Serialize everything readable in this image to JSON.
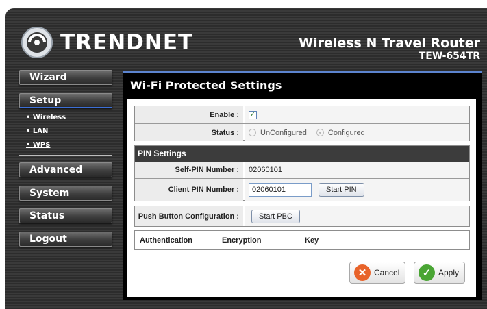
{
  "header": {
    "brand": "TRENDNET",
    "product": "Wireless N Travel Router",
    "model": "TEW-654TR"
  },
  "sidebar": {
    "items": [
      {
        "label": "Wizard"
      },
      {
        "label": "Setup"
      },
      {
        "label": "Advanced"
      },
      {
        "label": "System"
      },
      {
        "label": "Status"
      },
      {
        "label": "Logout"
      }
    ],
    "setup_submenu": [
      "Wireless",
      "LAN",
      "WPS"
    ],
    "submenu_bullet": "•"
  },
  "panel": {
    "title": "Wi-Fi Protected Settings",
    "enable": {
      "label": "Enable :",
      "checked": true,
      "check_glyph": "✓"
    },
    "status": {
      "label": "Status :",
      "options": [
        "UnConfigured",
        "Configured"
      ],
      "selected": "Configured"
    },
    "pin_settings": {
      "header": "PIN Settings",
      "self_pin_label": "Self-PIN Number :",
      "self_pin_value": "02060101",
      "client_pin_label": "Client PIN Number :",
      "client_pin_value": "02060101",
      "start_pin_button": "Start PIN"
    },
    "pbc": {
      "label": "Push Button Configuration :",
      "button": "Start PBC"
    },
    "security_table": {
      "columns": [
        "Authentication",
        "Encryption",
        "Key"
      ]
    },
    "actions": {
      "cancel": "Cancel",
      "apply": "Apply"
    }
  },
  "colors": {
    "accent_blue": "#5c84cf",
    "cancel_icon": "#e8632a",
    "apply_icon": "#4aa534"
  },
  "icons": {
    "logo": "trendnet-logo-icon",
    "cancel": "x-icon",
    "apply": "checkmark-icon"
  }
}
